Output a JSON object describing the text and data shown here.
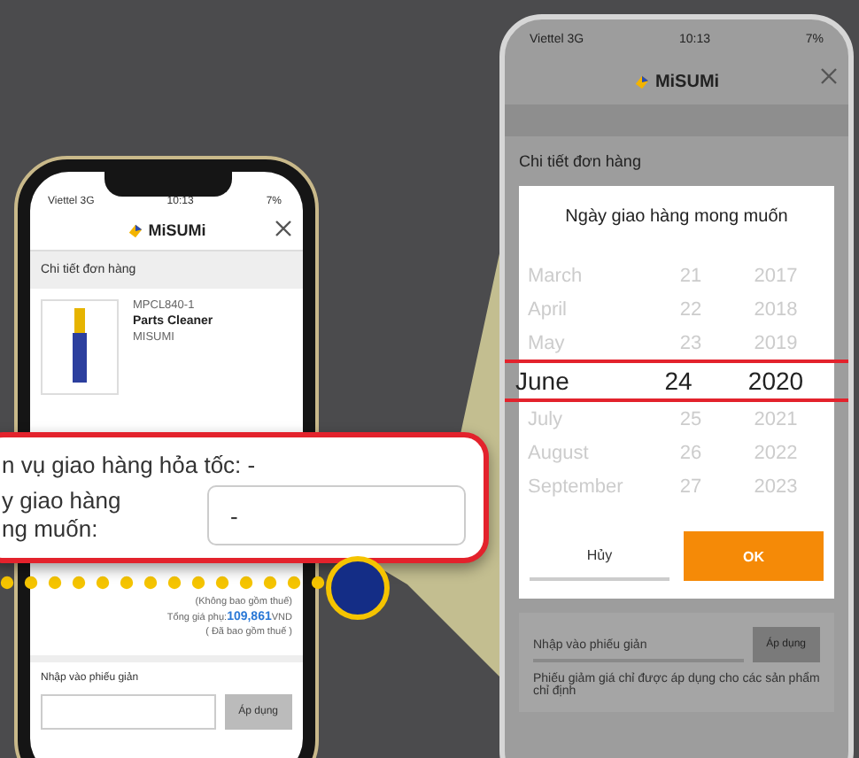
{
  "left_phone": {
    "status_bar": {
      "carrier": "Viettel 3G",
      "time": "10:13",
      "battery": "7%"
    },
    "logo": "MiSUMi",
    "section_title": "Chi tiết đơn hàng",
    "product": {
      "code": "MPCL840-1",
      "name": "Parts Cleaner",
      "brand": "MISUMI"
    },
    "totals": [
      {
        "label": "(Không bao gồm thuế)"
      },
      {
        "label": "Tổng giá phụ:",
        "amount": "109,861",
        "currency": "VND"
      },
      {
        "label": "( Đã bao gồm thuế )"
      }
    ],
    "coupon": {
      "title": "Nhập vào phiếu giản",
      "button": "Áp dụng"
    }
  },
  "callout": {
    "express_line": "n vụ giao hàng hỏa tốc: -",
    "date_label": [
      "y giao hàng",
      "ng muốn:"
    ],
    "date_value": "-"
  },
  "right_phone": {
    "status_bar": {
      "carrier": "Viettel 3G",
      "time": "10:13",
      "battery": "7%"
    },
    "logo": "MiSUMi",
    "section_title": "Chi tiết đơn hàng",
    "dialog": {
      "title": "Ngày giao hàng mong muốn",
      "rows": [
        {
          "month": "March",
          "day": "21",
          "year": "2017",
          "selected": false
        },
        {
          "month": "April",
          "day": "22",
          "year": "2018",
          "selected": false
        },
        {
          "month": "May",
          "day": "23",
          "year": "2019",
          "selected": false
        },
        {
          "month": "June",
          "day": "24",
          "year": "2020",
          "selected": true
        },
        {
          "month": "July",
          "day": "25",
          "year": "2021",
          "selected": false
        },
        {
          "month": "August",
          "day": "26",
          "year": "2022",
          "selected": false
        },
        {
          "month": "September",
          "day": "27",
          "year": "2023",
          "selected": false
        }
      ],
      "buttons": [
        {
          "label": "Hủy",
          "kind": "cancel"
        },
        {
          "label": "OK",
          "kind": "confirm"
        }
      ]
    },
    "coupon": {
      "title": "Nhập vào phiếu giản",
      "button": "Áp dụng",
      "note": "Phiếu giảm giá chỉ được áp dụng cho các sản phẩm chỉ định"
    }
  }
}
